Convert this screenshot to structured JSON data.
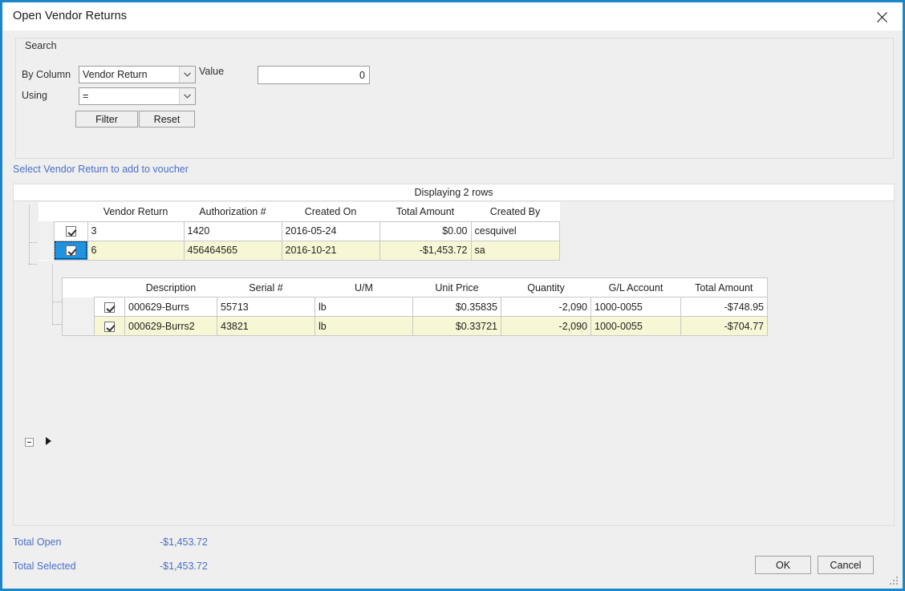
{
  "window": {
    "title": "Open Vendor Returns",
    "close_icon": "close-icon"
  },
  "search": {
    "legend": "Search",
    "by_column_label": "By Column",
    "by_column_value": "Vendor Return",
    "using_label": "Using",
    "using_value": "=",
    "value_label": "Value",
    "value_field": "0",
    "filter_button": "Filter",
    "reset_button": "Reset",
    "dropdown_icon": "chevron-down-icon"
  },
  "instruction": "Select Vendor Return to add to voucher",
  "grid": {
    "caption": "Displaying 2 rows",
    "columns": [
      "Vendor Return",
      "Authorization #",
      "Created On",
      "Total Amount",
      "Created By"
    ],
    "rows": [
      {
        "checked": true,
        "vendor_return": "3",
        "authorization": "1420",
        "created_on": "2016-05-24",
        "total_amount": "$0.00",
        "created_by": "cesquivel"
      },
      {
        "checked": true,
        "vendor_return": "6",
        "authorization": "456464565",
        "created_on": "2016-10-21",
        "total_amount": "-$1,453.72",
        "created_by": "sa"
      }
    ]
  },
  "detail_grid": {
    "columns": [
      "Description",
      "Serial #",
      "U/M",
      "Unit Price",
      "Quantity",
      "G/L Account",
      "Total Amount"
    ],
    "rows": [
      {
        "checked": true,
        "description": "000629-Burrs",
        "serial": "55713",
        "um": "lb",
        "unit_price": "$0.35835",
        "quantity": "-2,090",
        "gl_account": "1000-0055",
        "total_amount": "-$748.95"
      },
      {
        "checked": true,
        "description": "000629-Burrs2",
        "serial": "43821",
        "um": "lb",
        "unit_price": "$0.33721",
        "quantity": "-2,090",
        "gl_account": "1000-0055",
        "total_amount": "-$704.77"
      }
    ]
  },
  "totals": {
    "open_label": "Total Open",
    "open_value": "-$1,453.72",
    "selected_label": "Total Selected",
    "selected_value": "-$1,453.72"
  },
  "footer": {
    "ok_button": "OK",
    "cancel_button": "Cancel"
  },
  "colors": {
    "accent_border": "#1c86c8",
    "link_text": "#4a6ec8",
    "row_highlight": "#f7f7d5",
    "cell_selected": "#1f93e0"
  }
}
